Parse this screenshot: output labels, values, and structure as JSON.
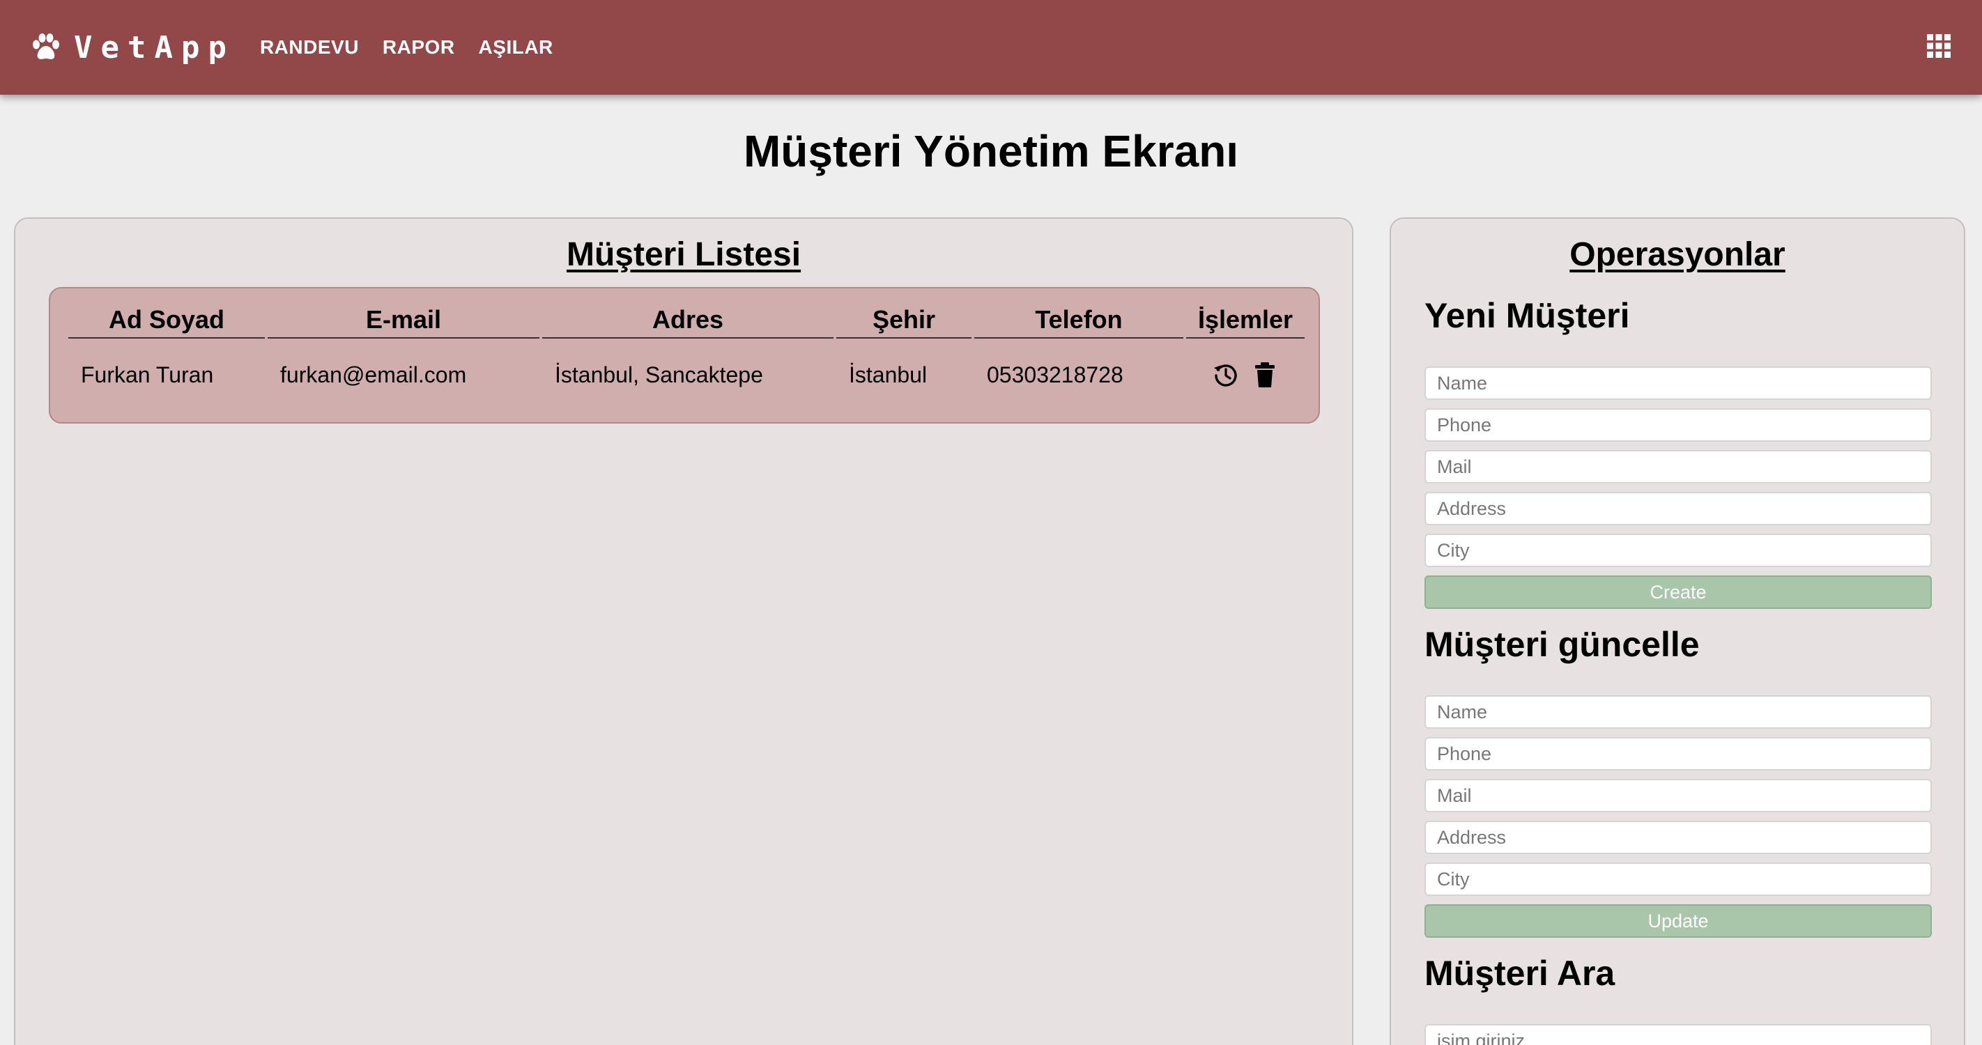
{
  "app": {
    "brand": "VetApp",
    "nav": [
      "RANDEVU",
      "RAPOR",
      "AŞILAR"
    ],
    "icons": {
      "brand": "paw-icon",
      "menu": "apps-grid-icon",
      "update_row": "refresh-icon",
      "delete_row": "trash-icon"
    }
  },
  "page": {
    "title": "Müşteri Yönetim Ekranı"
  },
  "list": {
    "heading": "Müşteri Listesi",
    "columns": [
      "Ad Soyad",
      "E-mail",
      "Adres",
      "Şehir",
      "Telefon",
      "İşlemler"
    ],
    "rows": [
      {
        "name": "Furkan Turan",
        "email": "furkan@email.com",
        "address": "İstanbul, Sancaktepe",
        "city": "İstanbul",
        "phone": "05303218728"
      }
    ]
  },
  "ops": {
    "heading": "Operasyonlar",
    "create": {
      "title": "Yeni Müşteri",
      "placeholders": {
        "name": "Name",
        "phone": "Phone",
        "mail": "Mail",
        "address": "Address",
        "city": "City"
      },
      "button": "Create"
    },
    "update": {
      "title": "Müşteri güncelle",
      "placeholders": {
        "name": "Name",
        "phone": "Phone",
        "mail": "Mail",
        "address": "Address",
        "city": "City"
      },
      "button": "Update"
    },
    "search": {
      "title": "Müşteri Ara",
      "placeholder": "isim giriniz..."
    }
  },
  "colors": {
    "topbar": "#924849",
    "table_bg": "#d1aeae",
    "panel_bg": "#e7e1e1",
    "button_green": "#aac6aa"
  }
}
